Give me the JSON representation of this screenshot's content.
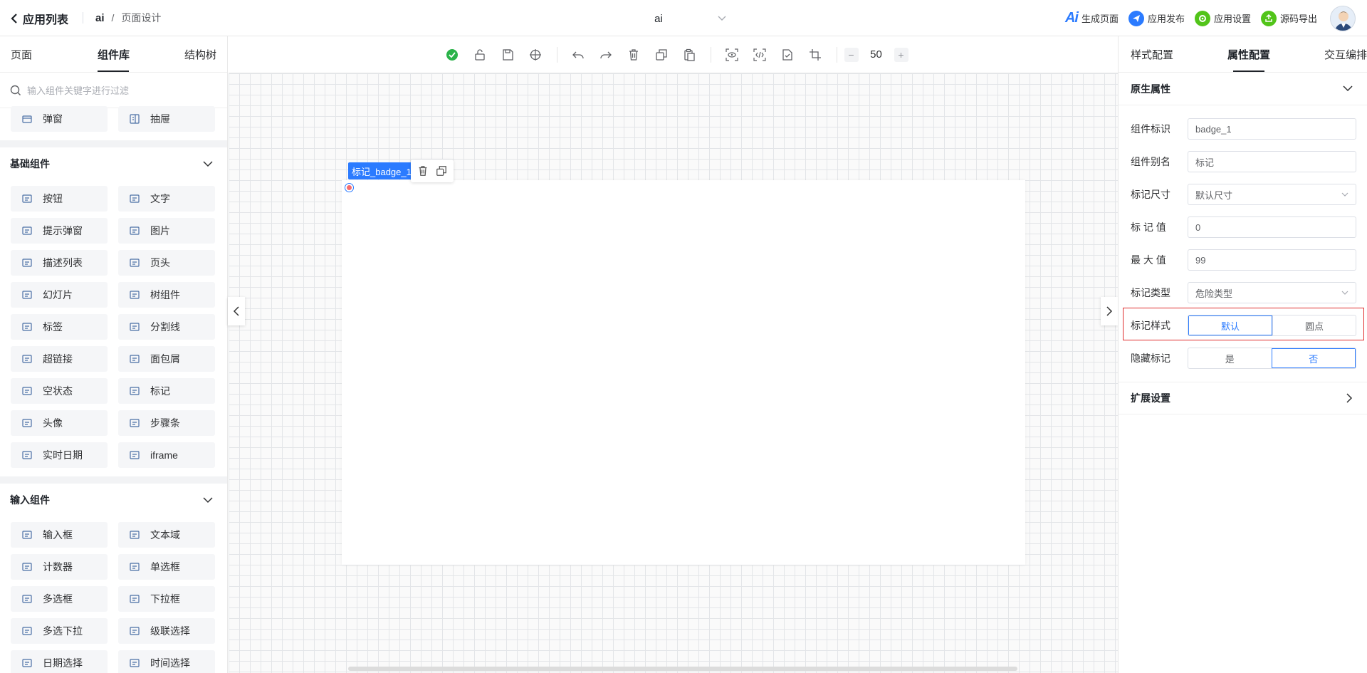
{
  "header": {
    "back_label": "应用列表",
    "app_name": "ai",
    "crumb_sep": "/",
    "page_name": "页面设计",
    "page_select": "ai",
    "actions": [
      {
        "label": "生成页面",
        "icon": "ai-logo",
        "color": "#2b7bff"
      },
      {
        "label": "应用发布",
        "icon": "send-icon",
        "color": "#2b7bff"
      },
      {
        "label": "应用设置",
        "icon": "gear-icon",
        "color": "#52c41a"
      },
      {
        "label": "源码导出",
        "icon": "export-icon",
        "color": "#52c41a"
      }
    ],
    "ai_logo_text": "Ai"
  },
  "left": {
    "tabs": [
      "页面",
      "组件库",
      "结构树"
    ],
    "active_tab": "组件库",
    "search_placeholder": "输入组件关键字进行过滤",
    "top_items": [
      {
        "label": "弹窗",
        "icon": "modal-icon"
      },
      {
        "label": "抽屉",
        "icon": "drawer-icon"
      }
    ],
    "basic": {
      "title": "基础组件",
      "items": [
        {
          "label": "按钮",
          "icon": "button-icon"
        },
        {
          "label": "文字",
          "icon": "text-icon"
        },
        {
          "label": "提示弹窗",
          "icon": "popup-icon"
        },
        {
          "label": "图片",
          "icon": "image-icon"
        },
        {
          "label": "描述列表",
          "icon": "desc-list-icon"
        },
        {
          "label": "页头",
          "icon": "page-header-icon"
        },
        {
          "label": "幻灯片",
          "icon": "slides-icon"
        },
        {
          "label": "树组件",
          "icon": "tree-icon"
        },
        {
          "label": "标签",
          "icon": "tag-icon"
        },
        {
          "label": "分割线",
          "icon": "divider-icon"
        },
        {
          "label": "超链接",
          "icon": "link-icon"
        },
        {
          "label": "面包屑",
          "icon": "breadcrumb-icon"
        },
        {
          "label": "空状态",
          "icon": "empty-icon"
        },
        {
          "label": "标记",
          "icon": "pin-icon"
        },
        {
          "label": "头像",
          "icon": "avatar-icon"
        },
        {
          "label": "步骤条",
          "icon": "steps-icon"
        },
        {
          "label": "实时日期",
          "icon": "calendar-icon"
        },
        {
          "label": "iframe",
          "icon": "iframe-icon"
        }
      ]
    },
    "input": {
      "title": "输入组件",
      "items": [
        {
          "label": "输入框",
          "icon": "input-icon"
        },
        {
          "label": "文本域",
          "icon": "textarea-icon"
        },
        {
          "label": "计数器",
          "icon": "counter-icon"
        },
        {
          "label": "单选框",
          "icon": "radio-icon"
        },
        {
          "label": "多选框",
          "icon": "checkbox-icon"
        },
        {
          "label": "下拉框",
          "icon": "select-icon"
        },
        {
          "label": "多选下拉",
          "icon": "multi-select-icon"
        },
        {
          "label": "级联选择",
          "icon": "cascader-icon"
        },
        {
          "label": "日期选择",
          "icon": "date-picker-icon"
        },
        {
          "label": "时间选择",
          "icon": "time-picker-icon"
        }
      ]
    }
  },
  "toolbar": {
    "zoom_minus": "−",
    "zoom": "50",
    "zoom_plus": "+"
  },
  "canvas": {
    "selected_label": "标记_badge_1"
  },
  "right": {
    "tabs": [
      "样式配置",
      "属性配置",
      "交互编排"
    ],
    "active_tab": "属性配置",
    "native_title": "原生属性",
    "fields": {
      "id_label": "组件标识",
      "id_value": "badge_1",
      "alias_label": "组件别名",
      "alias_value": "标记",
      "size_label": "标记尺寸",
      "size_value": "默认尺寸",
      "value_label": "标 记 值",
      "value_value": "0",
      "max_label": "最 大 值",
      "max_value": "99",
      "type_label": "标记类型",
      "type_value": "危险类型",
      "style_label": "标记样式",
      "style_options": [
        "默认",
        "圆点"
      ],
      "style_selected": "默认",
      "hidden_label": "隐藏标记",
      "hidden_options": [
        "是",
        "否"
      ],
      "hidden_selected": "否"
    },
    "ext_title": "扩展设置"
  }
}
